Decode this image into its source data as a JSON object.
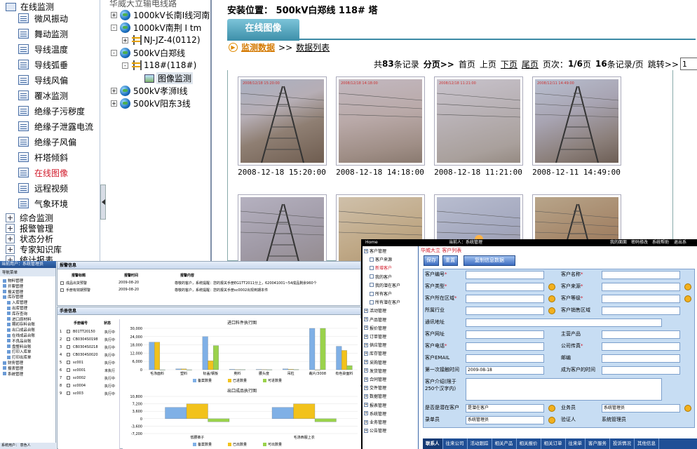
{
  "left_nav": {
    "group_open": "在线监测",
    "items": [
      "微风振动",
      "舞动监测",
      "导线温度",
      "导线弧垂",
      "导线风偏",
      "覆冰监测",
      "绝缘子污秽度",
      "绝缘子泄露电流",
      "绝缘子风偏",
      "杆塔倾斜",
      "在线图像",
      "远程视频",
      "气象环境"
    ],
    "active_index": 10,
    "groups_closed": [
      "综合监测",
      "报警管理",
      "状态分析",
      "专家知识库",
      "统计报表"
    ]
  },
  "tree": {
    "root": "华威大立输电线路",
    "nodes": [
      "1000kV长南I线河南",
      "1000kV南荆 I tm",
      "NJ-JZ-4(0112)",
      "500kV白郑线",
      "118#(118#)",
      "图像监测",
      "500kV孝浉I线",
      "500kV阳东3线"
    ]
  },
  "main": {
    "location_label": "安装位置：",
    "location_value": "500kV白郑线 118# 塔",
    "tab": "在线图像",
    "subnav_current": "监测数据",
    "subnav_sep": ">>",
    "subnav_link": "数据列表",
    "pager": {
      "total_prefix": "共",
      "total": "83",
      "total_suffix": "条记录",
      "paging": "分页>>",
      "first": "首页",
      "prev": "上页",
      "next": "下页",
      "last": "尾页",
      "page_label": "页次：",
      "page": "1/6",
      "page_unit": "页",
      "per_page": "16",
      "per_page_suffix": "条记录/页",
      "jump": "跳转>>",
      "select_value": "1"
    },
    "photos": [
      {
        "time": "2008-12-18 15:20:00",
        "stamp": "2008/12/18 15:20:00"
      },
      {
        "time": "2008-12-18 14:18:00",
        "stamp": "2008/12/18 14:18:00"
      },
      {
        "time": "2008-12-18 11:21:00",
        "stamp": "2008/12/18 11:21:00"
      },
      {
        "time": "2008-12-11 14:49:00",
        "stamp": "2008/12/11 14:49:00"
      }
    ]
  },
  "app2": {
    "header": "当前用户：系统管理员",
    "nav_title": "导航菜单",
    "nav": [
      "物料管理",
      "开票管理",
      "报关管理",
      "库存管理",
      "入库管理",
      "出库管理",
      "库存查询",
      "进口原材料",
      "期初存料台账",
      "出口成品台账",
      "在线成品台账",
      "不良品台账",
      "盘整料台账",
      "打印入库单",
      "打印出库单",
      "财务管理",
      "报表管理",
      "系统管理"
    ],
    "status": "系统用户：    意色人",
    "panel1_title": "报警信息",
    "panel1_cols": [
      "报警标题",
      "报警时间",
      "报警内容"
    ],
    "panel1_rows": [
      [
        "成品出货预警",
        "2009-08-20",
        "尊敬的客户，系统提醒：您的报关手册EG1TT2011分上，620041001~54成品剩余960个"
      ],
      [
        "手册有效期预警",
        "2009-08-20",
        "尊敬的客户，系统提醒：您的报关手册sc0002出现到期本件"
      ]
    ],
    "panel2_title": "手册信息",
    "list_cols": [
      "手册编号",
      "状态"
    ],
    "list_rows": [
      [
        "B01TT20150",
        "执行中"
      ],
      [
        "CB0304S0198",
        "执行中"
      ],
      [
        "CB0304S0218",
        "执行中"
      ],
      [
        "CB0304S0020",
        "执行中"
      ],
      [
        "sc001",
        "执行中"
      ],
      [
        "sc0001",
        "未执行"
      ],
      [
        "sc0002",
        "执行中"
      ],
      [
        "sc0004",
        "执行中"
      ],
      [
        "sc003",
        "执行中"
      ]
    ]
  },
  "chart_data": [
    {
      "type": "bar",
      "title": "进口料件执行图",
      "categories": [
        "毛涤面料",
        "塑料",
        "标盖/钢板",
        "英料",
        "腰头度",
        "吊粒",
        "裁片/3008",
        "有色染面料"
      ],
      "series": [
        {
          "name": "备案数量",
          "values": [
            20000,
            600,
            24000,
            300,
            250,
            600,
            30000,
            17000
          ]
        },
        {
          "name": "已进数量",
          "values": [
            20000,
            600,
            6500,
            150,
            200,
            400,
            0,
            14000
          ]
        },
        {
          "name": "可进数量",
          "values": [
            0,
            0,
            17500,
            150,
            50,
            200,
            30000,
            3000
          ]
        }
      ],
      "ylim": [
        0,
        30000
      ],
      "yticks": [
        "30,000",
        "24,000",
        "18,000",
        "12,000",
        "6,000",
        "0"
      ]
    },
    {
      "type": "bar",
      "title": "出口成品执行图",
      "categories": [
        "低腰裤子",
        "毛涤西服上衣"
      ],
      "series": [
        {
          "name": "备案数量",
          "values": [
            5500,
            5500
          ]
        },
        {
          "name": "已出数量",
          "values": [
            7200,
            7200
          ]
        },
        {
          "name": "可出数量",
          "values": [
            -1500,
            -1500
          ]
        }
      ],
      "ylim": [
        -7200,
        10800
      ],
      "yticks": [
        "10,800",
        "7,200",
        "3,600",
        "0",
        "-3,600",
        "-7,200"
      ]
    }
  ],
  "app3": {
    "top_left": "Home",
    "top_mid": "当前人：系统管理",
    "top_right": [
      "我的面面",
      "密码修改",
      "系统帮助",
      "退出系"
    ],
    "nav": [
      "客户管理",
      "客户来源",
      "新增客户",
      "我的客户",
      "我的潜在客户",
      "所有客户",
      "所有潜在客户",
      "活动管理",
      "产品管理",
      "报价管理",
      "订单管理",
      "供应管理",
      "库存管理",
      "采购管理",
      "发货管理",
      "合同管理",
      "交件管理",
      "数据管理",
      "报表管理",
      "系统管理",
      "业务管理",
      "公告管理"
    ],
    "nav_red_index": 2,
    "title": "华威大立 客户列表",
    "buttons": [
      "保存",
      "重置",
      "复制信息数据"
    ],
    "fields": [
      [
        "客户编号",
        "客户名称"
      ],
      [
        "客户类型",
        "客户来源"
      ],
      [
        "客户所在区域",
        "客户等级"
      ],
      [
        "所属行业",
        "客户销售区域"
      ],
      [
        "通讯地址",
        ""
      ],
      [
        "客户网址",
        "主营产品"
      ],
      [
        "客户电话",
        "公司传真"
      ],
      [
        "客户EMAIL",
        "邮编"
      ],
      [
        "第一次接触时间",
        "成为客户的时间"
      ]
    ],
    "first_contact_value": "2009-08-18",
    "intro_label": "客户介绍(限于250个汉字内)",
    "potential_label": "是否是潜在客户",
    "potential_value": "是潜在客户",
    "salesman_label": "业务员",
    "salesman_value": "系统管理员",
    "creator_label": "录单员",
    "creator_value": "系统管理员",
    "auditor_label": "验证人",
    "auditor_value": "系统管理员",
    "tabs": [
      "联系人",
      "往来公司",
      "活动跟踪",
      "相关产品",
      "相关报价",
      "相关订单",
      "往来单",
      "客户服务",
      "投诉情况",
      "其他信息"
    ]
  }
}
